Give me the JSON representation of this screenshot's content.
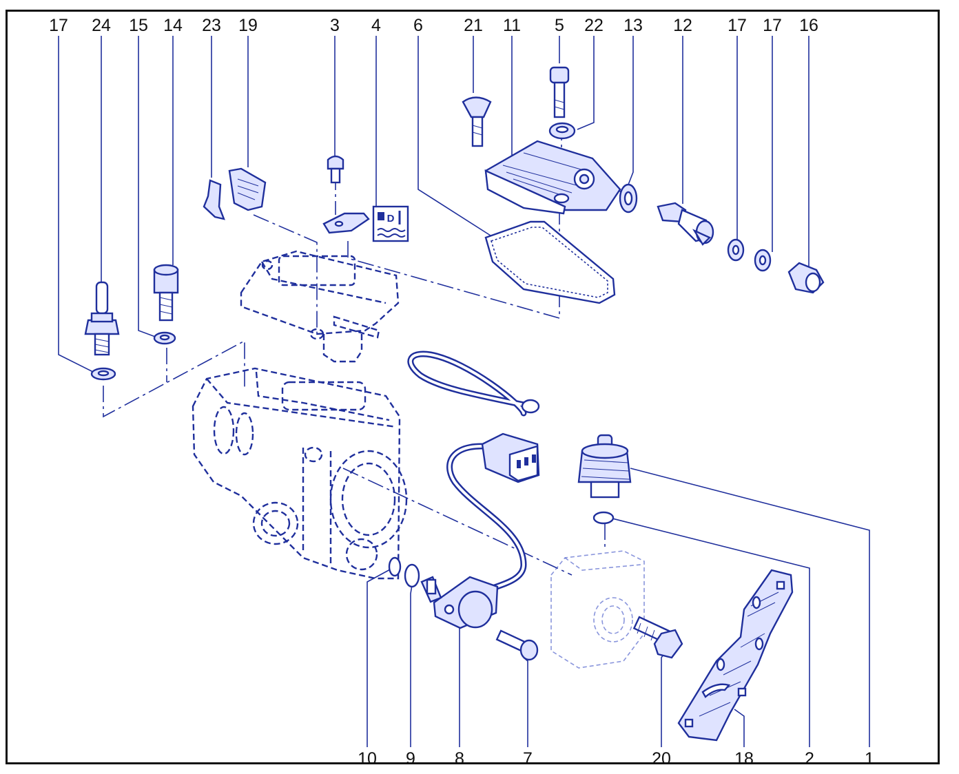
{
  "callouts": {
    "top": [
      "17",
      "24",
      "15",
      "14",
      "23",
      "19",
      "3",
      "4",
      "6",
      "21",
      "11",
      "5",
      "22",
      "13",
      "12",
      "17",
      "17",
      "16"
    ],
    "bottom": [
      "10",
      "9",
      "8",
      "7",
      "20",
      "18",
      "2",
      "1"
    ]
  },
  "colors": {
    "ink": "#1f2f9c",
    "fill": "#dfe3ff",
    "frame": "#111111"
  },
  "icons": {
    "coolant_symbol": "coolant-temperature-icon"
  }
}
